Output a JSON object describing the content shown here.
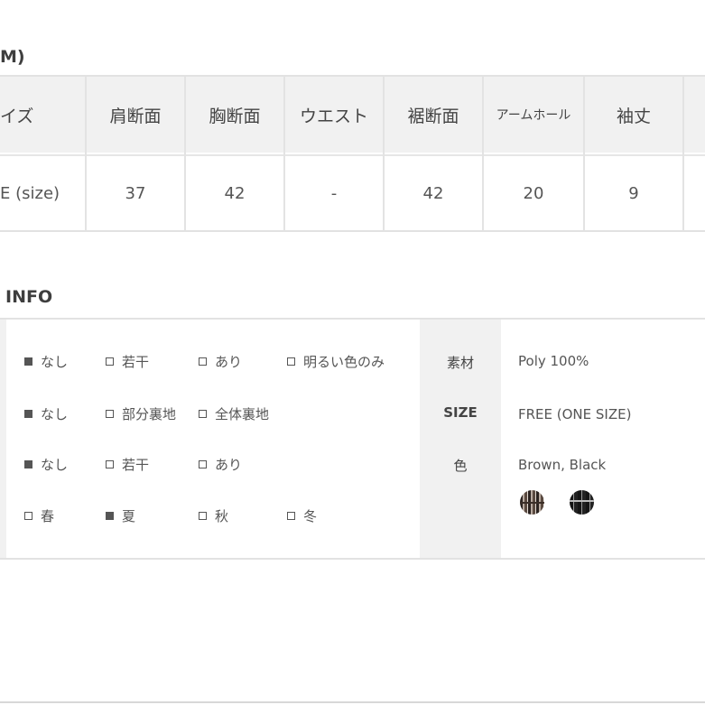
{
  "size_section": {
    "title": "M)",
    "headers": [
      "イズ",
      "肩断面",
      "胸断面",
      "ウエスト",
      "裾断面",
      "アームホール",
      "袖丈"
    ],
    "row": [
      "E (size)",
      "37",
      "42",
      "-",
      "42",
      "20",
      "9"
    ]
  },
  "info_section": {
    "title": "INFO",
    "option_rows": [
      [
        {
          "label": "なし",
          "checked": true
        },
        {
          "label": "若干",
          "checked": false
        },
        {
          "label": "あり",
          "checked": false
        },
        {
          "label": "明るい色のみ",
          "checked": false
        }
      ],
      [
        {
          "label": "なし",
          "checked": true
        },
        {
          "label": "部分裏地",
          "checked": false
        },
        {
          "label": "全体裏地",
          "checked": false
        }
      ],
      [
        {
          "label": "なし",
          "checked": true
        },
        {
          "label": "若干",
          "checked": false
        },
        {
          "label": "あり",
          "checked": false
        }
      ],
      [
        {
          "label": "春",
          "checked": false
        },
        {
          "label": "夏",
          "checked": true
        },
        {
          "label": "秋",
          "checked": false
        },
        {
          "label": "冬",
          "checked": false
        }
      ]
    ],
    "specs": [
      {
        "label": "素材",
        "value": "Poly 100%"
      },
      {
        "label": "SIZE",
        "value": "FREE (ONE SIZE)"
      },
      {
        "label": "色",
        "value": "Brown, Black"
      }
    ],
    "swatches": [
      {
        "name": "brown-plaid",
        "color": "#5a4a40"
      },
      {
        "name": "black-plaid",
        "color": "#151515"
      }
    ]
  }
}
